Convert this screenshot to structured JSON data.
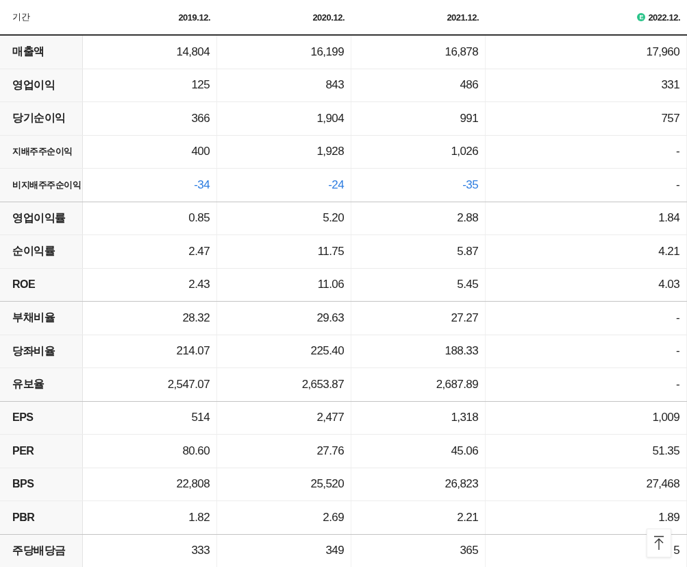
{
  "header": {
    "label": "기간",
    "columns": [
      {
        "text": "2019.12."
      },
      {
        "text": "2020.12."
      },
      {
        "text": "2021.12."
      },
      {
        "text": "2022.12.",
        "estimate_mark": "E"
      }
    ]
  },
  "groups": [
    {
      "rows": [
        {
          "label": "매출액",
          "values": [
            "14,804",
            "16,199",
            "16,878",
            "17,960"
          ]
        },
        {
          "label": "영업이익",
          "values": [
            "125",
            "843",
            "486",
            "331"
          ]
        },
        {
          "label": "당기순이익",
          "values": [
            "366",
            "1,904",
            "991",
            "757"
          ]
        },
        {
          "label": "지배주주순이익",
          "values": [
            "400",
            "1,928",
            "1,026",
            "-"
          ]
        },
        {
          "label": "비지배주주순이익",
          "values": [
            "-34",
            "-24",
            "-35",
            "-"
          ],
          "negative": [
            true,
            true,
            true,
            false
          ]
        }
      ]
    },
    {
      "rows": [
        {
          "label": "영업이익률",
          "values": [
            "0.85",
            "5.20",
            "2.88",
            "1.84"
          ]
        },
        {
          "label": "순이익률",
          "values": [
            "2.47",
            "11.75",
            "5.87",
            "4.21"
          ]
        },
        {
          "label": "ROE",
          "values": [
            "2.43",
            "11.06",
            "5.45",
            "4.03"
          ]
        }
      ]
    },
    {
      "rows": [
        {
          "label": "부채비율",
          "values": [
            "28.32",
            "29.63",
            "27.27",
            "-"
          ]
        },
        {
          "label": "당좌비율",
          "values": [
            "214.07",
            "225.40",
            "188.33",
            "-"
          ]
        },
        {
          "label": "유보율",
          "values": [
            "2,547.07",
            "2,653.87",
            "2,687.89",
            "-"
          ]
        }
      ]
    },
    {
      "rows": [
        {
          "label": "EPS",
          "values": [
            "514",
            "2,477",
            "1,318",
            "1,009"
          ]
        },
        {
          "label": "PER",
          "values": [
            "80.60",
            "27.76",
            "45.06",
            "51.35"
          ]
        },
        {
          "label": "BPS",
          "values": [
            "22,808",
            "25,520",
            "26,823",
            "27,468"
          ]
        },
        {
          "label": "PBR",
          "values": [
            "1.82",
            "2.69",
            "2.21",
            "1.89"
          ]
        }
      ]
    },
    {
      "rows": [
        {
          "label": "주당배당금",
          "values": [
            "333",
            "349",
            "365",
            "5"
          ]
        }
      ]
    }
  ],
  "scroll_top_button": true
}
